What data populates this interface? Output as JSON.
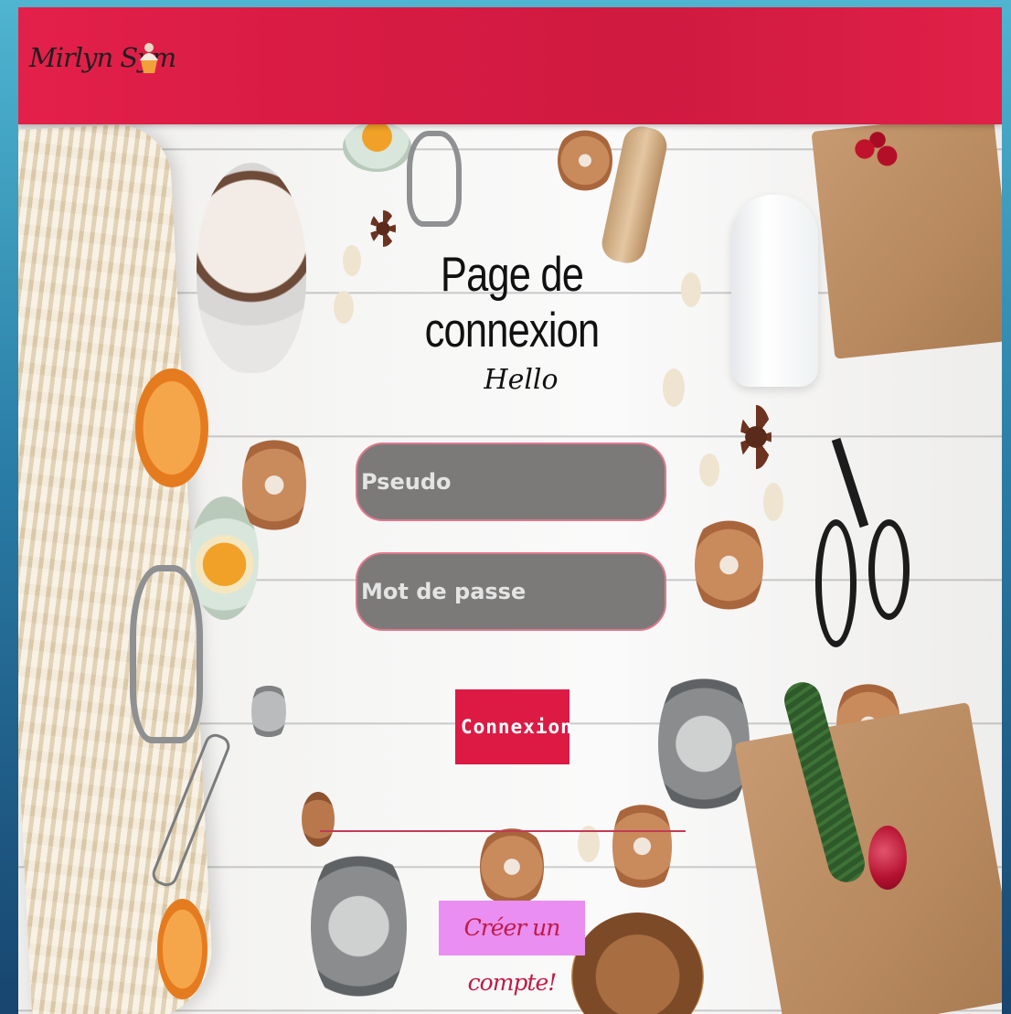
{
  "header": {
    "brand": "Mirlyn Sym",
    "brand_icon": "cupcake-icon",
    "color": "#dd1f46"
  },
  "login": {
    "title": "Page de connexion",
    "subtitle": "Hello",
    "username_placeholder": "Pseudo",
    "username_value": "",
    "password_placeholder": "Mot de passe",
    "password_value": "",
    "submit_label": "Connexion",
    "create_account_label": "Créer un compte!"
  }
}
